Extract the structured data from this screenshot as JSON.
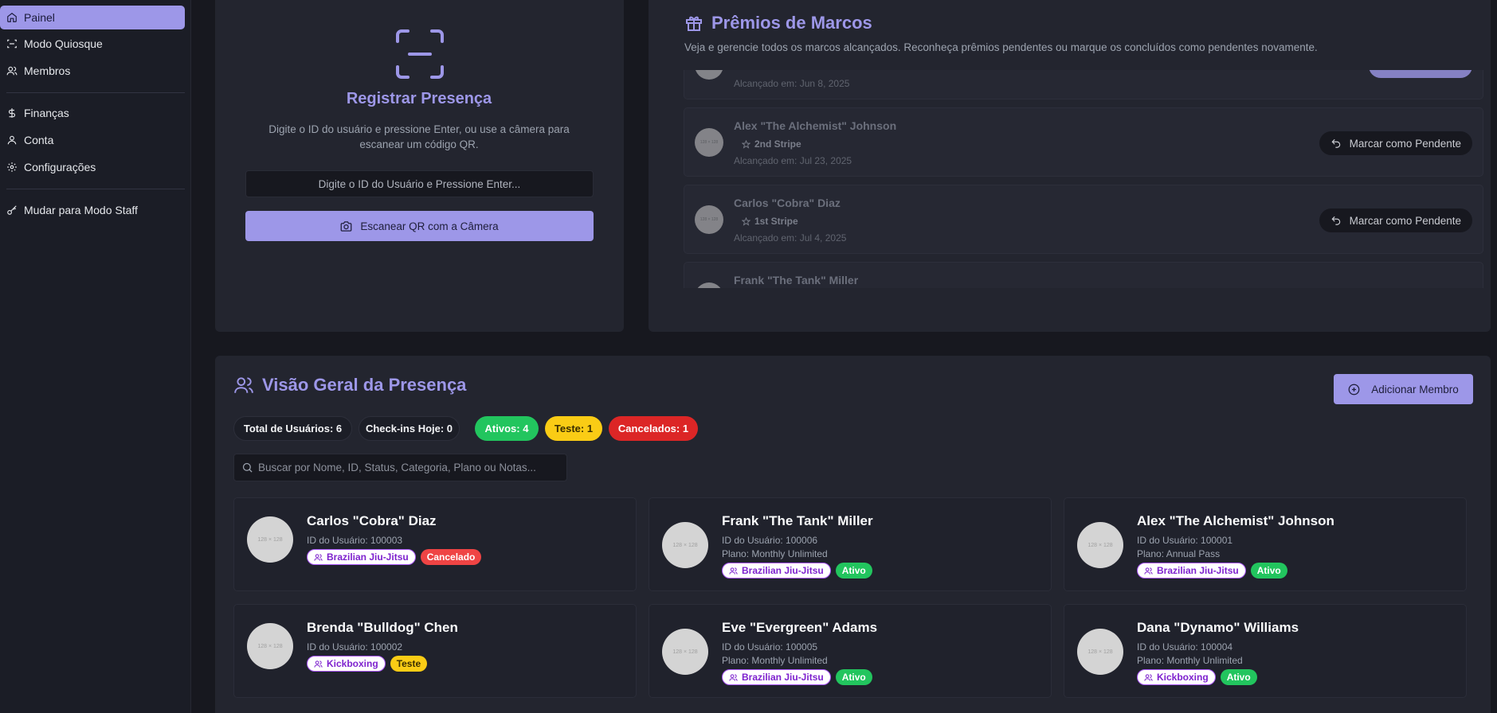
{
  "sidebar": {
    "items": [
      {
        "label": "Painel",
        "icon": "home-icon"
      },
      {
        "label": "Modo Quiosque",
        "icon": "scan-icon"
      },
      {
        "label": "Membros",
        "icon": "users-icon"
      },
      {
        "label": "Finanças",
        "icon": "dollar-icon"
      },
      {
        "label": "Conta",
        "icon": "user-icon"
      },
      {
        "label": "Configurações",
        "icon": "gear-icon"
      },
      {
        "label": "Mudar para Modo Staff",
        "icon": "key-icon"
      }
    ]
  },
  "register": {
    "title": "Registrar Presença",
    "description": "Digite o ID do usuário e pressione Enter, ou use a câmera para escanear um código QR.",
    "input_placeholder": "Digite o ID do Usuário e Pressione Enter...",
    "scan_label": "Escanear QR com a Câmera"
  },
  "milestones": {
    "title": "Prêmios de Marcos",
    "description": "Veja e gerencie todos os marcos alcançados. Reconheça prêmios pendentes ou marque os concluídos como pendentes novamente.",
    "items": [
      {
        "name": "",
        "stripe": "",
        "date": "Alcançado em: Jun 8, 2025",
        "button": ""
      },
      {
        "name": "Alex \"The Alchemist\" Johnson",
        "stripe": "2nd Stripe",
        "date": "Alcançado em: Jul 23, 2025",
        "button": "Marcar como Pendente"
      },
      {
        "name": "Carlos \"Cobra\" Diaz",
        "stripe": "1st Stripe",
        "date": "Alcançado em: Jul 4, 2025",
        "button": "Marcar como Pendente"
      },
      {
        "name": "Frank \"The Tank\" Miller",
        "stripe": "",
        "date": "",
        "button": ""
      }
    ]
  },
  "overview": {
    "title": "Visão Geral da Presença",
    "add_label": "Adicionar Membro",
    "stats": {
      "total": "Total de Usuários: 6",
      "checkins": "Check-ins Hoje: 0",
      "ativos": "Ativos: 4",
      "teste": "Teste: 1",
      "cancelados": "Cancelados: 1"
    },
    "search_placeholder": "Buscar por Nome, ID, Status, Categoria, Plano ou Notas...",
    "avatar_text": "128 × 128",
    "members": [
      {
        "name": "Carlos \"Cobra\" Diaz",
        "id": "ID do Usuário: 100003",
        "plan": "",
        "category": "Brazilian Jiu-Jitsu",
        "status": "Cancelado"
      },
      {
        "name": "Frank \"The Tank\" Miller",
        "id": "ID do Usuário: 100006",
        "plan": "Plano: Monthly Unlimited",
        "category": "Brazilian Jiu-Jitsu",
        "status": "Ativo"
      },
      {
        "name": "Alex \"The Alchemist\" Johnson",
        "id": "ID do Usuário: 100001",
        "plan": "Plano: Annual Pass",
        "category": "Brazilian Jiu-Jitsu",
        "status": "Ativo"
      },
      {
        "name": "Brenda \"Bulldog\" Chen",
        "id": "ID do Usuário: 100002",
        "plan": "",
        "category": "Kickboxing",
        "status": "Teste"
      },
      {
        "name": "Eve \"Evergreen\" Adams",
        "id": "ID do Usuário: 100005",
        "plan": "Plano: Monthly Unlimited",
        "category": "Brazilian Jiu-Jitsu",
        "status": "Ativo"
      },
      {
        "name": "Dana \"Dynamo\" Williams",
        "id": "ID do Usuário: 100004",
        "plan": "Plano: Monthly Unlimited",
        "category": "Kickboxing",
        "status": "Ativo"
      }
    ]
  },
  "colors": {
    "accent": "#9d97e8",
    "green": "#22c55e",
    "yellow": "#facc15",
    "red": "#dc2626"
  }
}
